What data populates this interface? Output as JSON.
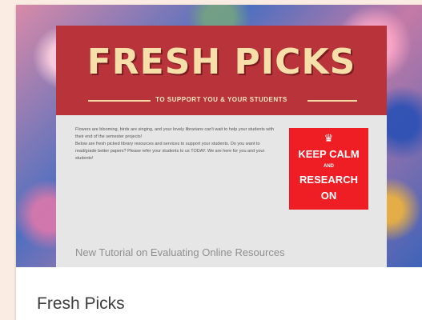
{
  "flyer": {
    "title": "FRESH PICKS",
    "subtitle": "TO SUPPORT YOU & YOUR STUDENTS",
    "paragraph1": "Flowers are blooming, birds are singing, and your lovely librarians can't wait to help your students with their end of the semester projects!",
    "paragraph2": "Below are fresh picked library resources and services to support your students. Do you want to read/grade better papers? Please refer your students to us TODAY. We are here for you and your students!",
    "keep_calm": {
      "crown": "♛",
      "line1": "KEEP CALM",
      "and": "AND",
      "line2": "RESEARCH",
      "line3": "ON"
    },
    "tutorial": "New Tutorial on Evaluating Online Resources"
  },
  "card": {
    "title": "Fresh Picks"
  },
  "colors": {
    "page_background": "#fbece3",
    "header_red": "#b8333a",
    "keep_calm_red": "#ee1e24",
    "title_cream": "#f6dfa9"
  }
}
